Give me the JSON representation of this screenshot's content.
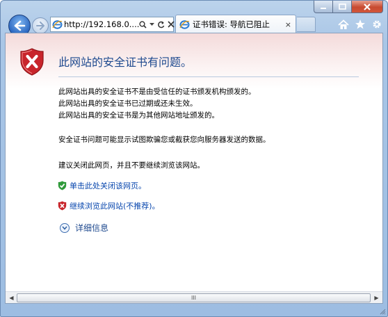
{
  "window": {
    "caption": {
      "minimize_icon": "minimize-icon",
      "maximize_icon": "maximize-icon",
      "close_icon": "close-icon"
    }
  },
  "toolbar": {
    "back_icon": "back-arrow-icon",
    "forward_icon": "forward-arrow-icon",
    "address": "http://192.168.0....",
    "search_icon": "search-icon",
    "refresh_icon": "refresh-icon",
    "stop_icon": "stop-icon",
    "tab_title": "证书错误: 导航已阻止",
    "tab_close": "×",
    "right_icons": [
      "home-icon",
      "favorites-star-icon",
      "tools-gear-icon"
    ]
  },
  "page": {
    "title": "此网站的安全证书有问题。",
    "lines_1": [
      "此网站出具的安全证书不是由受信任的证书颁发机构颁发的。",
      "此网站出具的安全证书已过期或还未生效。",
      "此网站出具的安全证书是为其他网站地址颁发的。"
    ],
    "line_2": "安全证书问题可能显示试图欺骗您或截获您向服务器发送的数据。",
    "line_3": "建议关闭此网页，并且不要继续浏览该网站。",
    "link_close": "单击此处关闭该网页。",
    "link_continue": "继续浏览此网站(不推荐)。",
    "details": "详细信息"
  },
  "scrollbar": {
    "thumb_grip": "III"
  },
  "colors": {
    "title": "#1f4a8f",
    "link": "#0645ad",
    "error_red": "#c8252b",
    "ok_green": "#2f9a3a"
  }
}
